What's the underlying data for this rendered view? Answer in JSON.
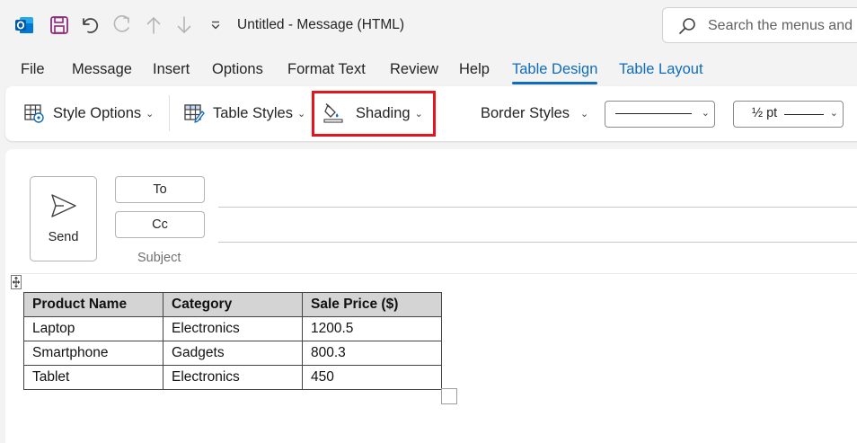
{
  "window": {
    "title": "Untitled  -  Message (HTML)"
  },
  "search": {
    "placeholder": "Search the menus and commands"
  },
  "quick_access": {
    "icons": [
      "outlook-logo",
      "save-icon",
      "undo-icon",
      "redo-icon",
      "previous-item-icon",
      "next-item-icon",
      "customize-toolbar-icon"
    ]
  },
  "tabs": [
    {
      "label": "File"
    },
    {
      "label": "Message"
    },
    {
      "label": "Insert"
    },
    {
      "label": "Options"
    },
    {
      "label": "Format Text"
    },
    {
      "label": "Review"
    },
    {
      "label": "Help"
    },
    {
      "label": "Table Design",
      "active": true
    },
    {
      "label": "Table Layout"
    }
  ],
  "ribbon": {
    "style_options": "Style Options",
    "table_styles": "Table Styles",
    "shading": "Shading",
    "border_styles": "Border Styles",
    "pen_weight": "½ pt"
  },
  "compose": {
    "send_label": "Send",
    "to_label": "To",
    "cc_label": "Cc",
    "subject_label": "Subject"
  },
  "table": {
    "headers": [
      "Product Name",
      "Category",
      "Sale Price ($)"
    ],
    "rows": [
      [
        "Laptop",
        "Electronics",
        "1200.5"
      ],
      [
        "Smartphone",
        "Gadgets",
        "800.3"
      ],
      [
        "Tablet",
        "Electronics",
        "450"
      ]
    ]
  },
  "colors": {
    "accent": "#0f6cbd",
    "highlight": "#e3161f",
    "header_fill": "#d4d4d4"
  }
}
